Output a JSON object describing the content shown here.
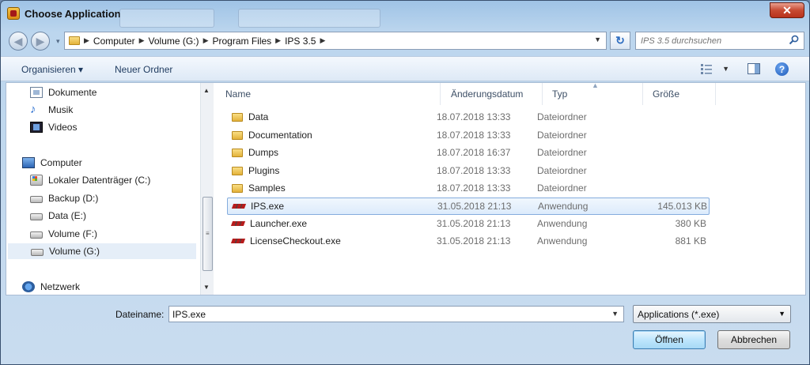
{
  "window": {
    "title": "Choose Application",
    "close_glyph": "✕"
  },
  "address": {
    "crumbs": [
      "Computer",
      "Volume (G:)",
      "Program Files",
      "IPS 3.5"
    ],
    "search_placeholder": "IPS 3.5 durchsuchen"
  },
  "toolbar": {
    "organize_label": "Organisieren ▾",
    "new_folder_label": "Neuer Ordner",
    "help_glyph": "?"
  },
  "nav": {
    "items": [
      {
        "label": "Dokumente",
        "icon": "documents-icon"
      },
      {
        "label": "Musik",
        "icon": "music-icon"
      },
      {
        "label": "Videos",
        "icon": "videos-icon"
      },
      {
        "label": "Computer",
        "icon": "computer-icon"
      },
      {
        "label": "Lokaler Datenträger (C:)",
        "icon": "system-drive-icon"
      },
      {
        "label": "Backup (D:)",
        "icon": "drive-icon"
      },
      {
        "label": "Data (E:)",
        "icon": "drive-icon"
      },
      {
        "label": "Volume (F:)",
        "icon": "drive-icon"
      },
      {
        "label": "Volume (G:)",
        "icon": "drive-icon",
        "selected": true
      },
      {
        "label": "Netzwerk",
        "icon": "network-icon"
      }
    ]
  },
  "list": {
    "columns": [
      "Name",
      "Änderungsdatum",
      "Typ",
      "Größe"
    ],
    "rows": [
      {
        "name": "Data",
        "date": "18.07.2018 13:33",
        "type": "Dateiordner",
        "size": "",
        "kind": "folder"
      },
      {
        "name": "Documentation",
        "date": "18.07.2018 13:33",
        "type": "Dateiordner",
        "size": "",
        "kind": "folder"
      },
      {
        "name": "Dumps",
        "date": "18.07.2018 16:37",
        "type": "Dateiordner",
        "size": "",
        "kind": "folder"
      },
      {
        "name": "Plugins",
        "date": "18.07.2018 13:33",
        "type": "Dateiordner",
        "size": "",
        "kind": "folder"
      },
      {
        "name": "Samples",
        "date": "18.07.2018 13:33",
        "type": "Dateiordner",
        "size": "",
        "kind": "folder"
      },
      {
        "name": "IPS.exe",
        "date": "31.05.2018 21:13",
        "type": "Anwendung",
        "size": "145.013 KB",
        "kind": "exe",
        "selected": true
      },
      {
        "name": "Launcher.exe",
        "date": "31.05.2018 21:13",
        "type": "Anwendung",
        "size": "380 KB",
        "kind": "exe"
      },
      {
        "name": "LicenseCheckout.exe",
        "date": "31.05.2018 21:13",
        "type": "Anwendung",
        "size": "881 KB",
        "kind": "exe"
      }
    ]
  },
  "footer": {
    "filename_label": "Dateiname:",
    "filename_value": "IPS.exe",
    "filter_value": "Applications (*.exe)",
    "open_label": "Öffnen",
    "cancel_label": "Abbrechen"
  }
}
